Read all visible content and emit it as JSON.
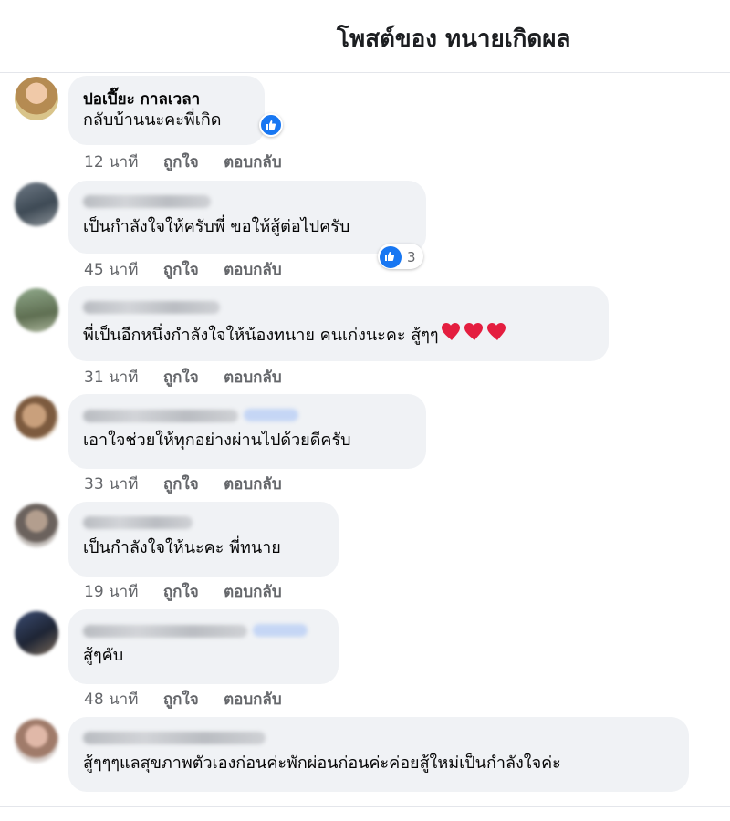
{
  "header": {
    "title": "โพสต์ของ ทนายเกิดผล"
  },
  "comments": [
    {
      "author": "ปอเปี๊ยะ กาลเวลา",
      "text": "กลับบ้านนะคะพี่เกิด",
      "time": "12 นาที",
      "like": "ถูกใจ",
      "reply": "ตอบกลับ"
    },
    {
      "author": "",
      "text": "เป็นกำลังใจให้ครับพี่ ขอให้สู้ต่อไปครับ",
      "time": "45 นาที",
      "like": "ถูกใจ",
      "reply": "ตอบกลับ",
      "reaction_count": "3"
    },
    {
      "author": "",
      "text": "พี่เป็นอีกหนึ่งกำลังใจให้น้องทนาย คนเก่งนะคะ สู้ๆๆ",
      "time": "31 นาที",
      "like": "ถูกใจ",
      "reply": "ตอบกลับ"
    },
    {
      "author": "",
      "text": "เอาใจช่วยให้ทุกอย่างผ่านไปด้วยดีครับ",
      "time": "33 นาที",
      "like": "ถูกใจ",
      "reply": "ตอบกลับ"
    },
    {
      "author": "",
      "text": "เป็นกำลังใจให้นะคะ พี่ทนาย",
      "time": "19 นาที",
      "like": "ถูกใจ",
      "reply": "ตอบกลับ"
    },
    {
      "author": "",
      "text": "สู้ๆคับ",
      "time": "48 นาที",
      "like": "ถูกใจ",
      "reply": "ตอบกลับ"
    },
    {
      "author": "",
      "text": "สู้ๆๆๆแลสุขภาพตัวเองก่อนค่ะพักผ่อนก่อนค่ะค่อยสู้ใหม่เป็นกำลังใจค่ะ"
    }
  ],
  "icons": {
    "like": "thumbs-up-icon",
    "heart": "heart-icon"
  },
  "colors": {
    "accent": "#1877f2",
    "bubble": "#f0f2f5",
    "meta": "#65676b",
    "heart": "#e41e3f"
  }
}
